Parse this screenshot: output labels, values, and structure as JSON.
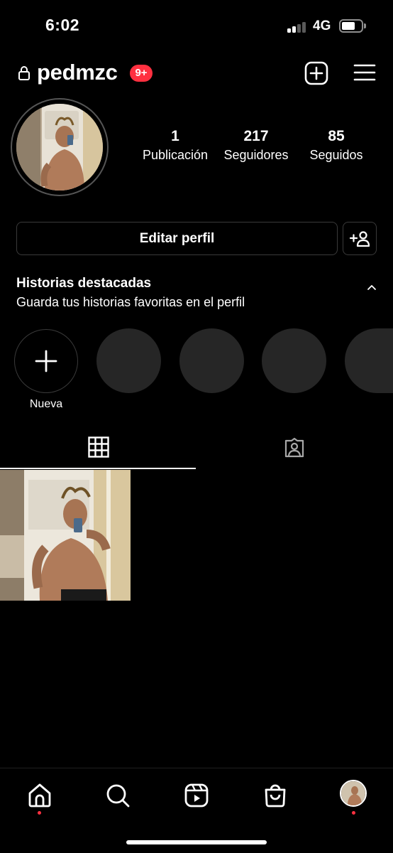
{
  "status_bar": {
    "time": "6:02",
    "network": "4G"
  },
  "header": {
    "username": "pedmzc",
    "notification_badge": "9+"
  },
  "profile": {
    "stats": [
      {
        "value": "1",
        "label": "Publicación"
      },
      {
        "value": "217",
        "label": "Seguidores"
      },
      {
        "value": "85",
        "label": "Seguidos"
      }
    ],
    "edit_profile_label": "Editar perfil"
  },
  "highlights": {
    "title": "Historias destacadas",
    "subtitle": "Guarda tus historias favoritas en el perfil",
    "new_label": "Nueva"
  },
  "tabs": [
    {
      "icon": "grid-icon",
      "active": true
    },
    {
      "icon": "tagged-icon",
      "active": false
    }
  ],
  "posts_count": 1,
  "bottom_nav": [
    "home-icon",
    "search-icon",
    "reels-icon",
    "shop-icon",
    "profile-avatar"
  ],
  "colors": {
    "background": "#000000",
    "badge": "#ff3040",
    "placeholder": "#262626"
  }
}
